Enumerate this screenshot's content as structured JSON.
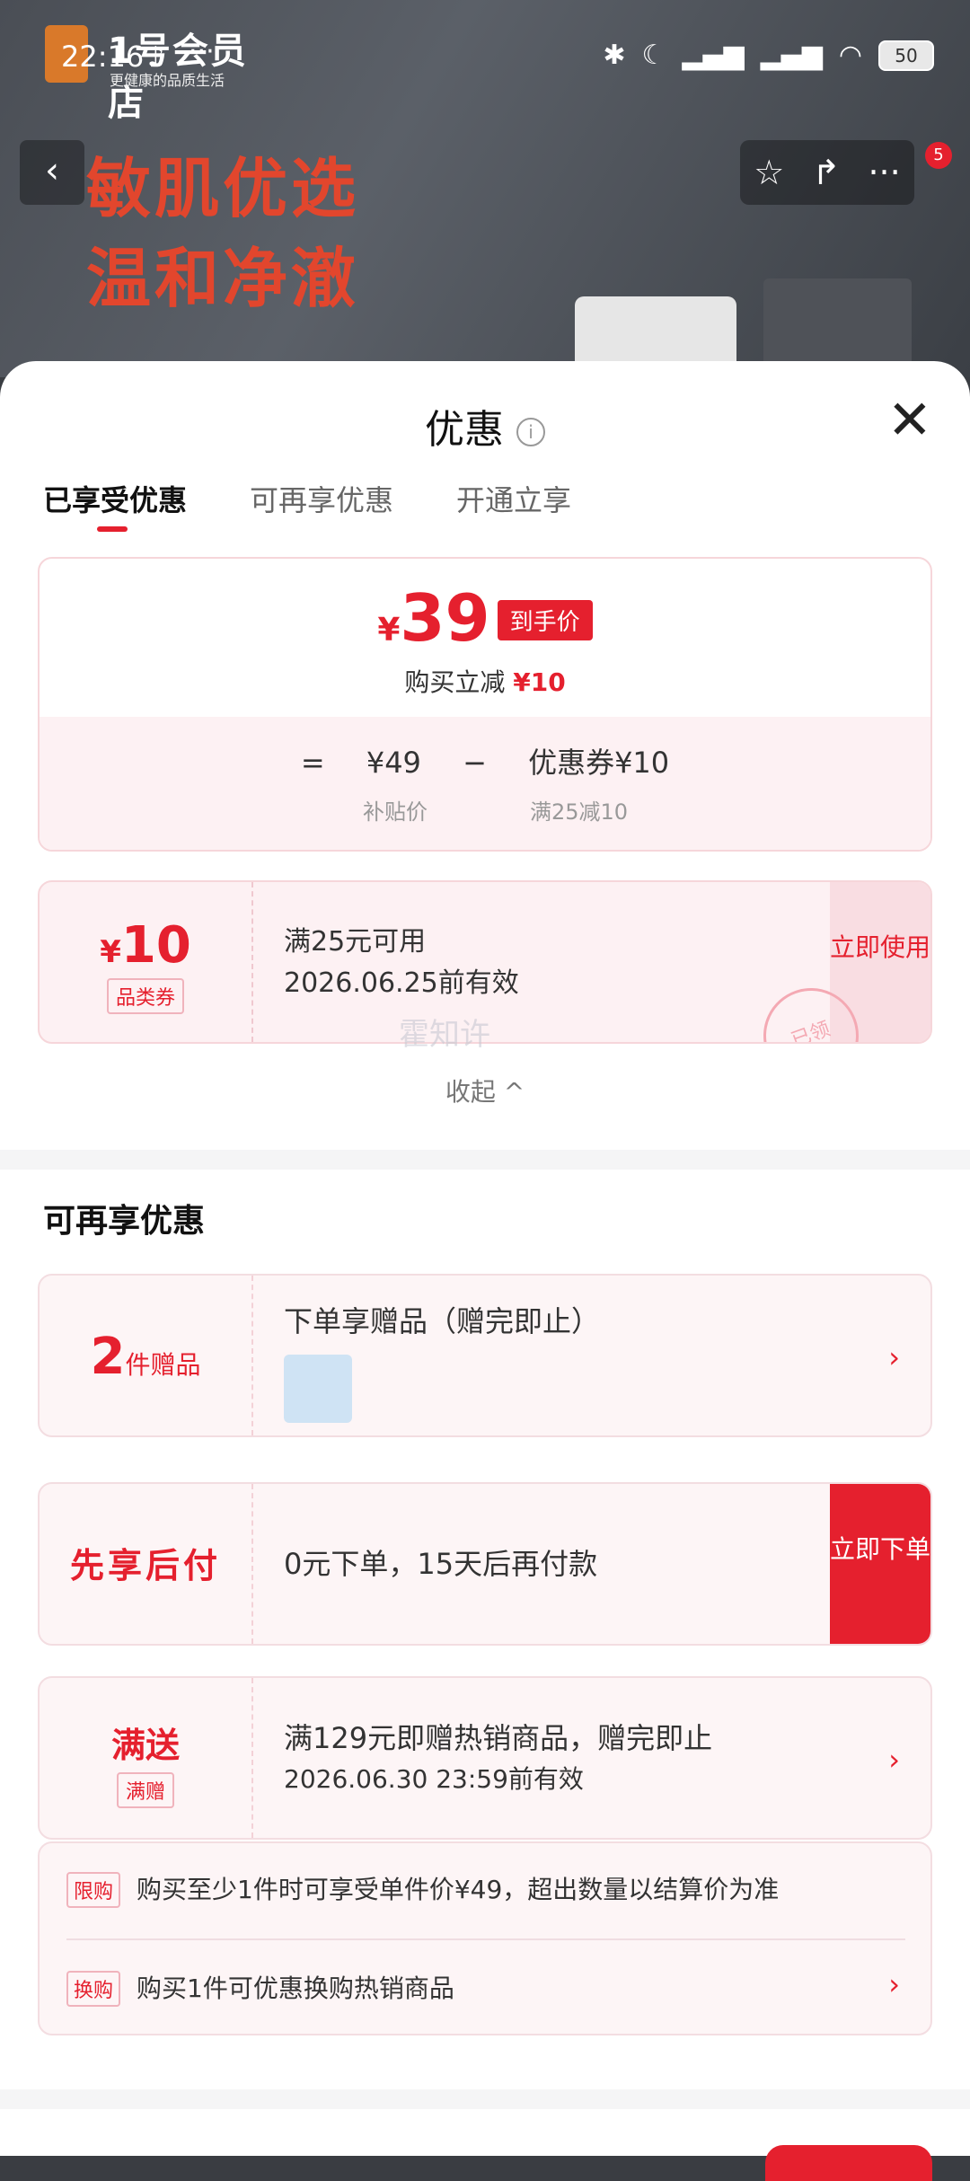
{
  "status": {
    "time": "22:16",
    "battery": "50",
    "icons": [
      "bluetooth-icon",
      "moon-icon",
      "signal-5g-icon",
      "signal-5g-icon",
      "wifi-icon"
    ]
  },
  "brand": {
    "name": "1号会员店",
    "tagline": "更健康的品质生活"
  },
  "banner": {
    "line1": "敏肌优选",
    "line2": "温和净澈"
  },
  "notification_count": "5",
  "sheet": {
    "title": "优惠",
    "tabs": [
      "已享受优惠",
      "可再享优惠",
      "开通立享"
    ]
  },
  "price_card": {
    "yen": "¥",
    "price": "39",
    "tag": "到手价",
    "sub_prefix": "购买立减",
    "sub_amount": "¥10",
    "formula_eq": "=",
    "formula_base": "¥49",
    "formula_minus": "−",
    "formula_coupon": "优惠券¥10",
    "cap_base": "补贴价",
    "cap_coupon": "满25减10"
  },
  "coupon": {
    "yen": "¥",
    "amount": "10",
    "badge": "品类券",
    "line1": "满25元可用",
    "line2": "2026.06.25前有效",
    "action": "立即使用",
    "stamp": "已领"
  },
  "watermark": "霍知许",
  "collapse_label": "收起 ^",
  "section2_title": "可再享优惠",
  "offers": {
    "gift": {
      "count": "2",
      "unit": "件赠品",
      "text": "下单享赠品（赠完即止）"
    },
    "bnpl": {
      "label": "先享后付",
      "text": "0元下单，15天后再付款",
      "action": "立即下单"
    },
    "gift_threshold": {
      "label": "满送",
      "badge": "满赠",
      "line1": "满129元即赠热销商品，赠完即止",
      "line2": "2026.06.30 23:59前有效"
    }
  },
  "rules": [
    {
      "tag": "限购",
      "text": "购买至少1件时可享受单件价¥49，超出数量以结算价为准"
    },
    {
      "tag": "换购",
      "text": "购买1件可优惠换购热销商品"
    }
  ]
}
